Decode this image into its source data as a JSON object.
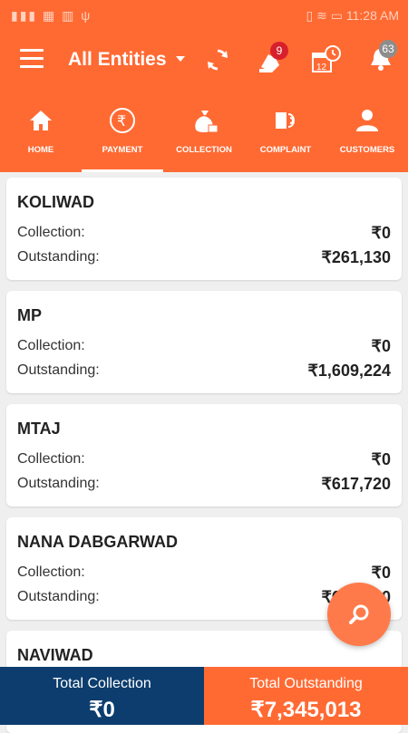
{
  "status_bar": {
    "time": "11:28 AM"
  },
  "header": {
    "entity_selector": "All Entities",
    "notifications_badge": "9",
    "alerts_badge": "63"
  },
  "tabs": [
    {
      "label": "HOME",
      "icon": "home-icon"
    },
    {
      "label": "PAYMENT",
      "icon": "rupee-icon"
    },
    {
      "label": "COLLECTION",
      "icon": "money-bag-icon"
    },
    {
      "label": "COMPLAINT",
      "icon": "complaint-icon"
    },
    {
      "label": "CUSTOMERS",
      "icon": "person-icon"
    }
  ],
  "active_tab": "PAYMENT",
  "labels": {
    "collection": "Collection:",
    "outstanding": "Outstanding:"
  },
  "entities": [
    {
      "name": "KOLIWAD",
      "collection": "₹0",
      "outstanding": "₹261,130"
    },
    {
      "name": "MP",
      "collection": "₹0",
      "outstanding": "₹1,609,224"
    },
    {
      "name": "MTAJ",
      "collection": "₹0",
      "outstanding": "₹617,720"
    },
    {
      "name": "NANA DABGARWAD",
      "collection": "₹0",
      "outstanding": "₹606,900"
    },
    {
      "name": "NAVIWAD"
    }
  ],
  "footer": {
    "total_collection_label": "Total Collection",
    "total_collection_value": "₹0",
    "total_outstanding_label": "Total Outstanding",
    "total_outstanding_value": "₹7,345,013"
  },
  "colors": {
    "primary": "#ff6a33",
    "footer_left": "#0c3d6e",
    "fab": "#ff7a4a",
    "badge_red": "#d8202c",
    "badge_grey": "#8d8d8d"
  }
}
